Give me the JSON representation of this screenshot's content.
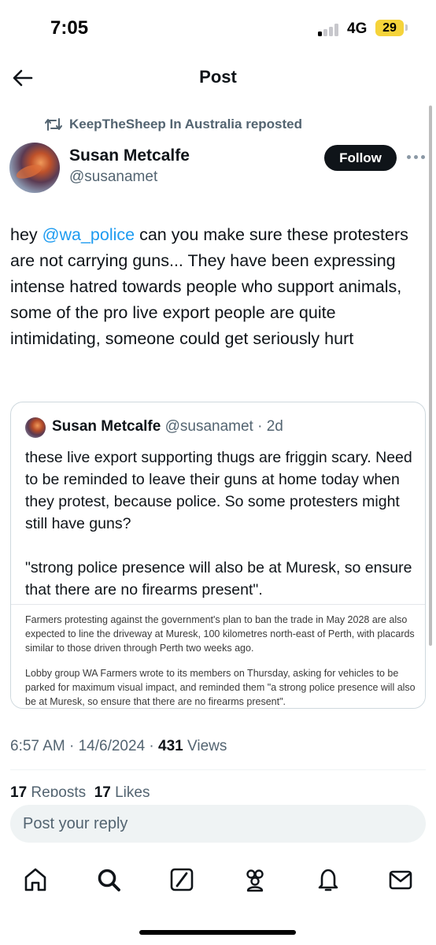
{
  "status_bar": {
    "time": "7:05",
    "network": "4G",
    "battery": "29"
  },
  "nav": {
    "title": "Post",
    "back_icon": "arrow-left-icon"
  },
  "repost": {
    "text": "KeepTheSheep In Australia reposted",
    "icon": "repost-icon"
  },
  "author": {
    "name": "Susan Metcalfe",
    "handle": "@susanamet",
    "follow_label": "Follow",
    "more_icon": "more-dots-icon"
  },
  "post": {
    "before_mention": "hey ",
    "mention": "@wa_police",
    "after_mention": " can you make sure these protesters are not carrying guns... They have been expressing intense hatred towards people who support animals, some of the pro live export people are quite intimidating, someone could get seriously hurt"
  },
  "quote": {
    "name": "Susan Metcalfe",
    "handle": "@susanamet",
    "separator": " · ",
    "age": "2d",
    "text": "these live export supporting thugs are friggin scary. Need to be reminded to leave their guns at home today when they protest, because police. So some protesters might still have guns?\n\n\"strong police presence will also be at Muresk, so ensure that there are no firearms present\".",
    "media_paragraph_1": "Farmers protesting against the government's plan to ban the trade in May 2028 are also expected to line the driveway at Muresk, 100 kilometres north-east of Perth, with placards similar to those driven through Perth two weeks ago.",
    "media_paragraph_2": "Lobby group WA Farmers wrote to its members on Thursday, asking for vehicles to be parked for maximum visual impact, and reminded them \"a strong police presence will also be at Muresk, so ensure that there are no firearms present\"."
  },
  "meta": {
    "time": "6:57 AM",
    "date": "14/6/2024",
    "separator": " · ",
    "views_count": "431",
    "views_label": " Views"
  },
  "stats": {
    "reposts_count": "17",
    "reposts_label": " Reposts",
    "likes_count": "17",
    "likes_label": " Likes"
  },
  "reply": {
    "placeholder": "Post your reply"
  },
  "tabs": [
    {
      "name": "home",
      "icon": "home-icon"
    },
    {
      "name": "search",
      "icon": "search-icon"
    },
    {
      "name": "grok",
      "icon": "grok-icon"
    },
    {
      "name": "communities",
      "icon": "communities-icon"
    },
    {
      "name": "notifications",
      "icon": "bell-icon"
    },
    {
      "name": "messages",
      "icon": "mail-icon"
    }
  ]
}
